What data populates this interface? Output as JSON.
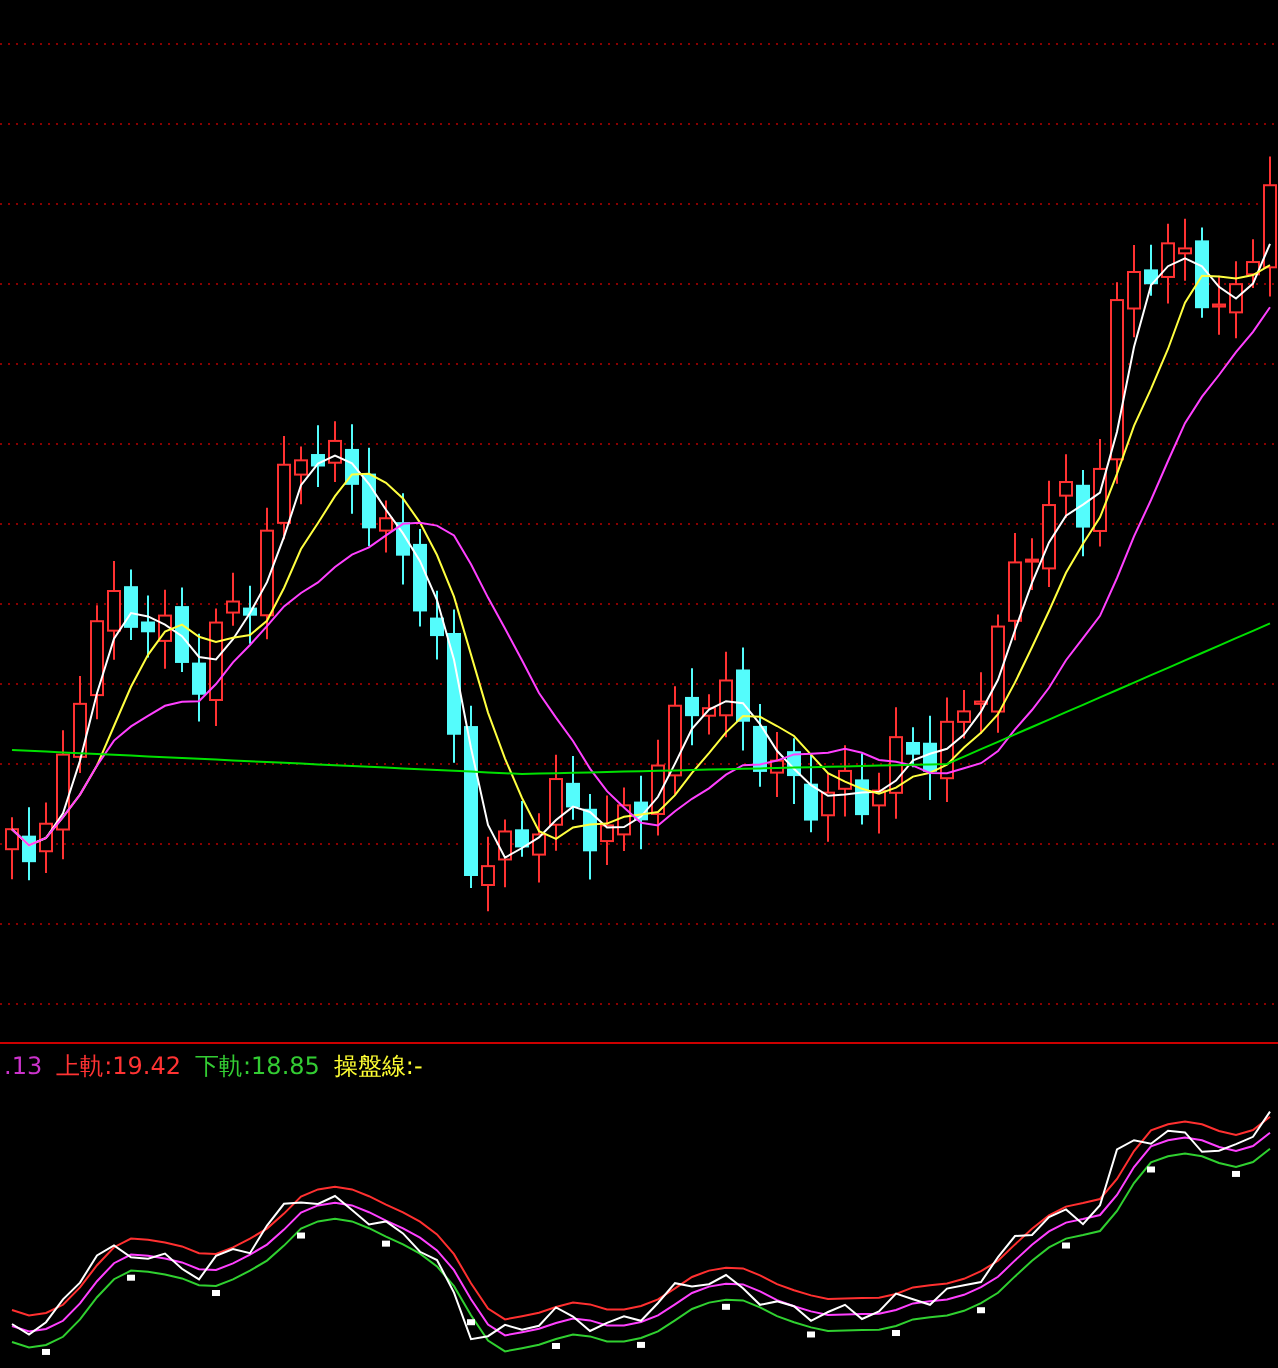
{
  "indicator_legend": [
    {
      "text": ".13",
      "color": "#cc33cc"
    },
    {
      "text": "上軌:19.42",
      "color": "#ff3333"
    },
    {
      "text": "下軌:18.85",
      "color": "#33cc33"
    },
    {
      "text": "操盤線:-",
      "color": "#ffff33"
    }
  ]
}
